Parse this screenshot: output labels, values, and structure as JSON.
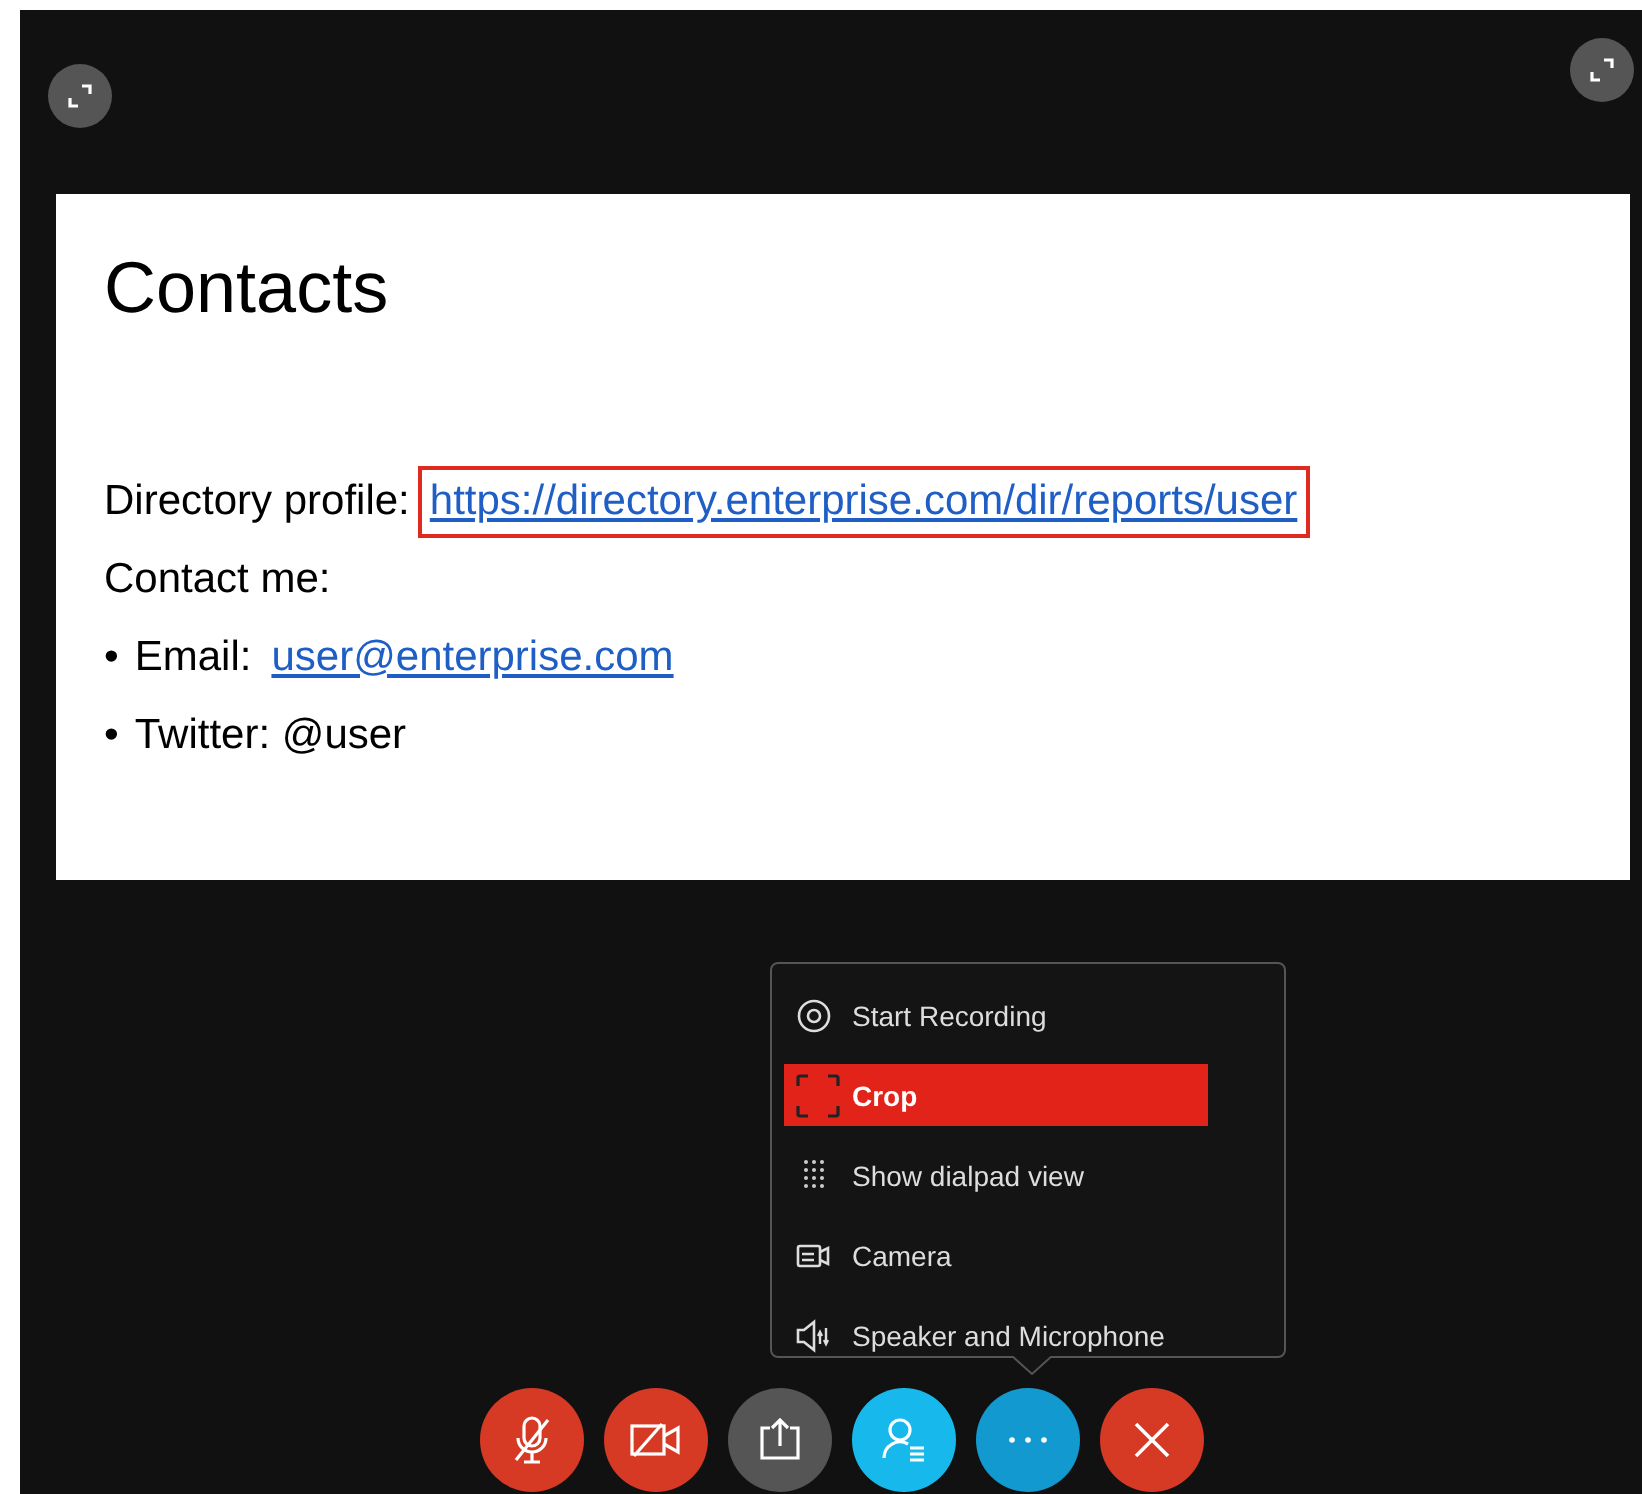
{
  "slide": {
    "title": "Contacts",
    "profile": {
      "label": "Directory profile:",
      "link": "https://directory.enterprise.com/dir/reports/user",
      "highlighted": true
    },
    "subheading": "Contact me:",
    "bullets": [
      {
        "bullet": "•",
        "label": "Email:",
        "link": "user@enterprise.com"
      },
      {
        "bullet": "•",
        "label": "Twitter: @user"
      }
    ]
  },
  "menu": {
    "items": [
      {
        "kind": "record",
        "label": "Start Recording",
        "selected": false
      },
      {
        "kind": "crop",
        "label": "Crop",
        "selected": true
      },
      {
        "kind": "dialpad",
        "label": "Show dialpad view",
        "selected": false
      },
      {
        "kind": "camera",
        "label": "Camera",
        "selected": false
      },
      {
        "kind": "speaker",
        "label": "Speaker and Microphone",
        "selected": false
      }
    ]
  },
  "controls": [
    {
      "kind": "mic-off",
      "color": "#d63a25"
    },
    {
      "kind": "video-off",
      "color": "#d63a25"
    },
    {
      "kind": "share",
      "color": "#555555"
    },
    {
      "kind": "participants",
      "color": "#17b9ec"
    },
    {
      "kind": "more",
      "color": "#129ad0"
    },
    {
      "kind": "end",
      "color": "#d63a25"
    }
  ]
}
